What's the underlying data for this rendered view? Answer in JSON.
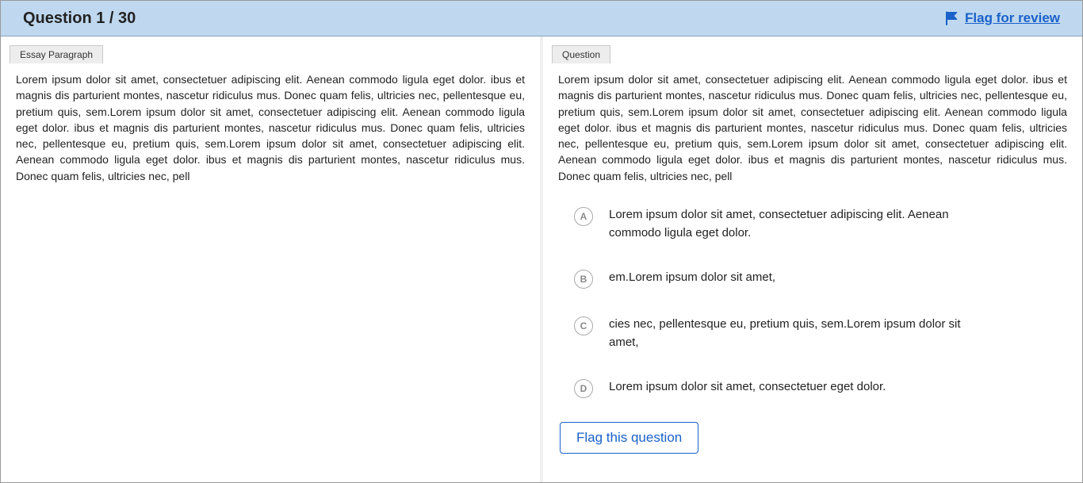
{
  "header": {
    "title": "Question 1 / 30",
    "flag_link_label": "Flag for review"
  },
  "left_pane": {
    "tab_label": "Essay Paragraph",
    "passage": "Lorem ipsum dolor sit amet, consectetuer adipiscing elit. Aenean commodo ligula eget dolor. ibus et magnis dis parturient montes, nascetur ridiculus mus. Donec quam felis, ultricies nec, pellentesque eu, pretium quis, sem.Lorem ipsum dolor sit amet, consectetuer adipiscing elit. Aenean commodo ligula eget dolor. ibus et magnis dis parturient montes, nascetur ridiculus mus. Donec quam felis, ultricies nec, pellentesque eu, pretium quis, sem.Lorem ipsum dolor sit amet, consectetuer adipiscing elit. Aenean commodo ligula eget dolor. ibus et magnis dis parturient montes, nascetur ridiculus mus. Donec quam felis, ultricies nec, pell"
  },
  "right_pane": {
    "tab_label": "Question",
    "stem": "Lorem ipsum dolor sit amet, consectetuer adipiscing elit. Aenean commodo ligula eget dolor. ibus et magnis dis parturient montes, nascetur ridiculus mus. Donec quam felis, ultricies nec, pellentesque eu, pretium quis, sem.Lorem ipsum dolor sit amet, consectetuer adipiscing elit. Aenean commodo ligula eget dolor. ibus et magnis dis parturient montes, nascetur ridiculus mus. Donec quam felis, ultricies nec, pellentesque eu, pretium quis, sem.Lorem ipsum dolor sit amet, consectetuer adipiscing elit. Aenean commodo ligula eget dolor. ibus et magnis dis parturient montes, nascetur ridiculus mus. Donec quam felis, ultricies nec, pell",
    "options": [
      {
        "letter": "A",
        "text": "Lorem ipsum dolor sit amet, consectetuer adipiscing elit. Aenean commodo ligula eget dolor."
      },
      {
        "letter": "B",
        "text": "em.Lorem ipsum dolor sit amet,"
      },
      {
        "letter": "C",
        "text": "cies nec, pellentesque eu, pretium quis, sem.Lorem ipsum dolor sit amet,"
      },
      {
        "letter": "D",
        "text": "Lorem ipsum dolor sit amet, consectetuer eget dolor."
      }
    ],
    "flag_button_label": "Flag this question"
  }
}
